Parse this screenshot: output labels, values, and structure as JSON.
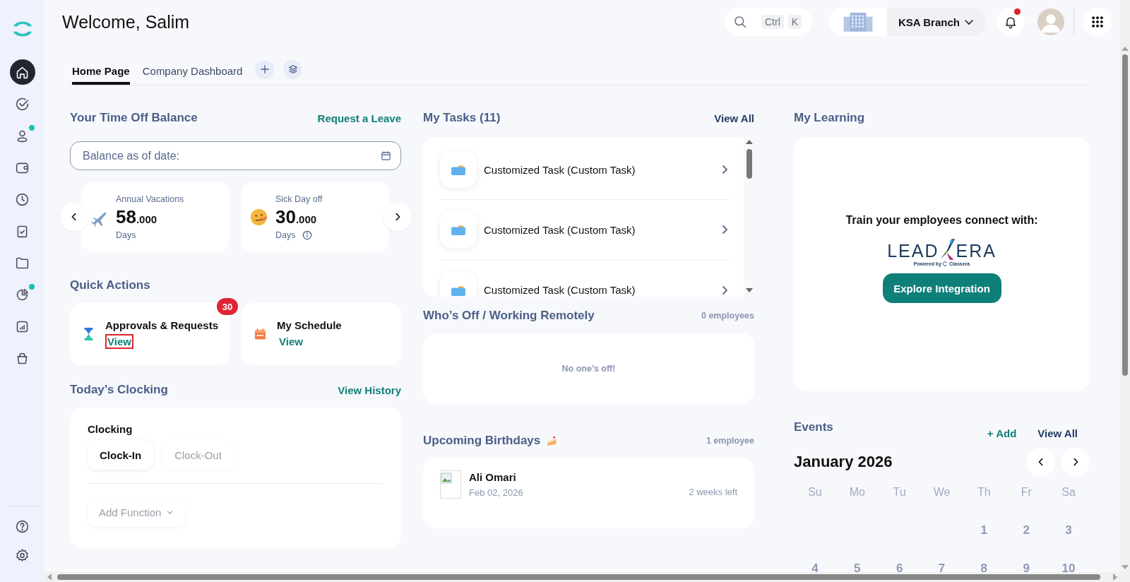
{
  "sidebar": {
    "items": [
      {
        "selected": true,
        "notification": false
      },
      {
        "selected": false,
        "notification": false
      },
      {
        "selected": false,
        "notification": true
      },
      {
        "selected": false,
        "notification": false
      },
      {
        "selected": false,
        "notification": false
      },
      {
        "selected": false,
        "notification": false
      },
      {
        "selected": false,
        "notification": false
      },
      {
        "selected": false,
        "notification": true
      },
      {
        "selected": false,
        "notification": false
      },
      {
        "selected": false,
        "notification": false
      }
    ]
  },
  "header": {
    "title": "Welcome, Salim",
    "search": {
      "shortcut": [
        "Ctrl",
        "K"
      ]
    },
    "branch": {
      "name": "KSA Branch"
    },
    "notifications": {
      "unread": true
    }
  },
  "tabs": [
    {
      "label": "Home Page",
      "selected": true
    },
    {
      "label": "Company Dashboard",
      "selected": false
    }
  ],
  "time_off": {
    "title": "Your Time Off Balance",
    "action": "Request a Leave",
    "date_field": {
      "placeholder": "Balance as of date:"
    },
    "balances": [
      {
        "kind": "vacation",
        "label": "Annual Vacations",
        "amount": "58",
        "decimals": ".000",
        "unit": "Days",
        "info": false
      },
      {
        "kind": "sick",
        "label": "Sick Day off",
        "amount": "30",
        "decimals": ".000",
        "unit": "Days",
        "info": true
      }
    ]
  },
  "quick_actions": {
    "title": "Quick Actions",
    "items": [
      {
        "kind": "approvals",
        "title": "Approvals & Requests",
        "link": "View",
        "badge": "30",
        "highlighted": true
      },
      {
        "kind": "schedule",
        "title": "My Schedule",
        "link": "View",
        "highlighted": false
      }
    ]
  },
  "clocking": {
    "title": "Today’s Clocking",
    "action": "View History",
    "label": "Clocking",
    "buttons": [
      {
        "label": "Clock-In",
        "disabled": false
      },
      {
        "label": "Clock-Out",
        "disabled": true
      }
    ],
    "add_function": "Add Function"
  },
  "tasks": {
    "title": "My Tasks (11)",
    "action": "View All",
    "items": [
      "Customized Task (Custom Task)",
      "Customized Task (Custom Task)",
      "Customized Task (Custom Task)"
    ]
  },
  "whos_off": {
    "title": "Who’s Off / Working Remotely",
    "count": "0 employees",
    "empty": "No one’s off!"
  },
  "birthdays": {
    "title": "Upcoming Birthdays",
    "count": "1 employee",
    "items": [
      {
        "name": "Ali Omari",
        "date": "Feb 02, 2026",
        "remaining": "2 weeks left"
      }
    ]
  },
  "learning": {
    "title": "My Learning",
    "prompt": "Train your employees connect with:",
    "logo": {
      "left": "LEAD",
      "right": "ERA",
      "tagline": "Powered by",
      "brand": "Classera"
    },
    "button": "Explore Integration"
  },
  "events": {
    "title": "Events",
    "add": "+ Add",
    "action": "View All",
    "month": "January 2026",
    "weekdays": [
      "Su",
      "Mo",
      "Tu",
      "We",
      "Th",
      "Fr",
      "Sa"
    ],
    "weeks": [
      {
        "right_aligned": true,
        "days": [
          "1",
          "2",
          "3"
        ]
      },
      {
        "days": [
          "4",
          "5",
          "6",
          "7",
          "8",
          "9",
          "10"
        ]
      }
    ]
  }
}
